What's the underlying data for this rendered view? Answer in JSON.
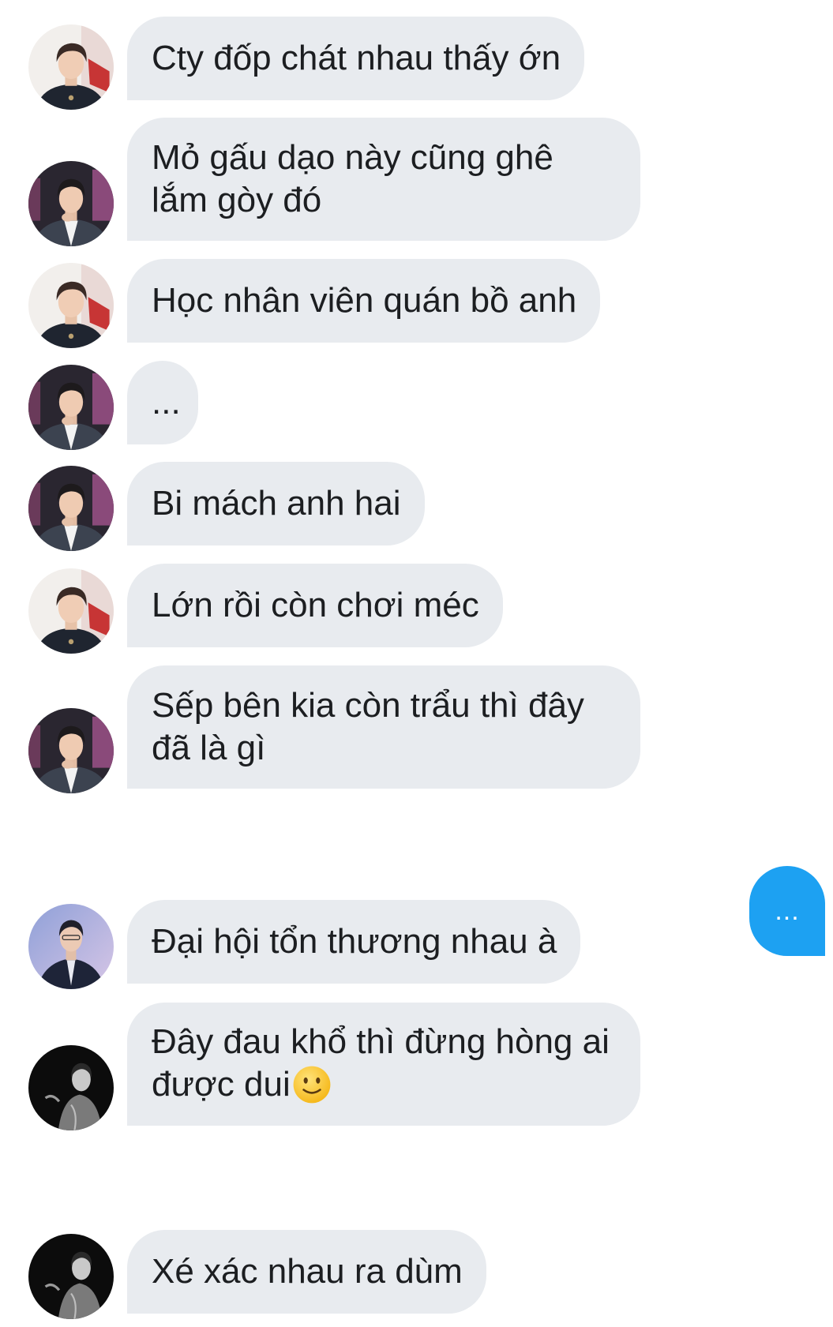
{
  "conversation": {
    "messages": [
      {
        "sender": "avatar-a",
        "text": "Cty đốp chát nhau thấy ớn"
      },
      {
        "sender": "avatar-b",
        "text": "Mỏ gấu dạo này cũng ghê lắm gòy đó"
      },
      {
        "sender": "avatar-a",
        "text": "Học nhân viên quán bồ anh"
      },
      {
        "sender": "avatar-b",
        "text": "..."
      },
      {
        "sender": "avatar-b",
        "text": "Bi mách anh hai"
      },
      {
        "sender": "avatar-a",
        "text": "Lớn rồi còn chơi méc"
      },
      {
        "sender": "avatar-b",
        "text": "Sếp bên kia còn trẩu thì đây đã là gì"
      },
      {
        "sender": "me",
        "text": "..."
      },
      {
        "sender": "avatar-c",
        "text": "Đại hội tổn thương nhau à"
      },
      {
        "sender": "avatar-d",
        "text": "Đây đau khổ thì đừng hòng ai được dui",
        "emoji": "slightly-smiling-face"
      },
      {
        "sender": "avatar-d",
        "text": "Xé xác nhau ra dùm"
      }
    ]
  },
  "colors": {
    "received_bubble": "#e8ebef",
    "sent_bubble": "#1da1f2",
    "text": "#1c1e21",
    "background": "#ffffff"
  }
}
